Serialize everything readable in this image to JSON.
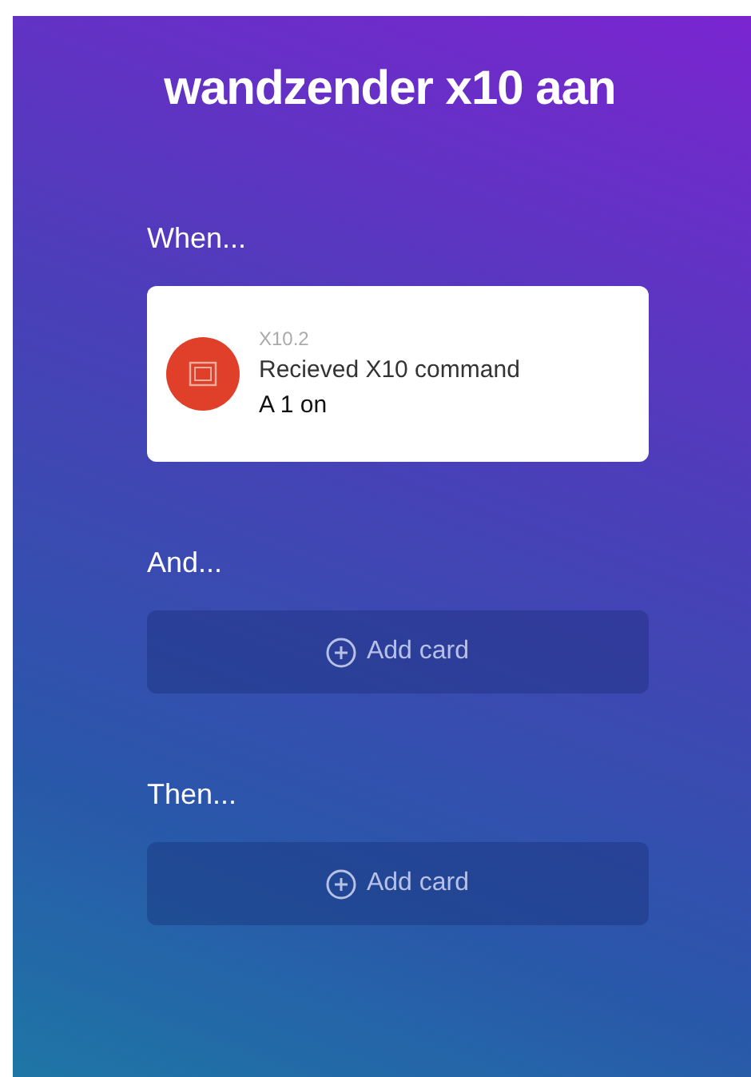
{
  "title": "wandzender x10 aan",
  "sections": [
    {
      "label": "When...",
      "cards": [
        {
          "app": "X10.2",
          "title": "Recieved X10 command",
          "value": "A 1 on"
        }
      ]
    },
    {
      "label": "And...",
      "add_button": "Add card"
    },
    {
      "label": "Then...",
      "add_button": "Add card"
    }
  ]
}
